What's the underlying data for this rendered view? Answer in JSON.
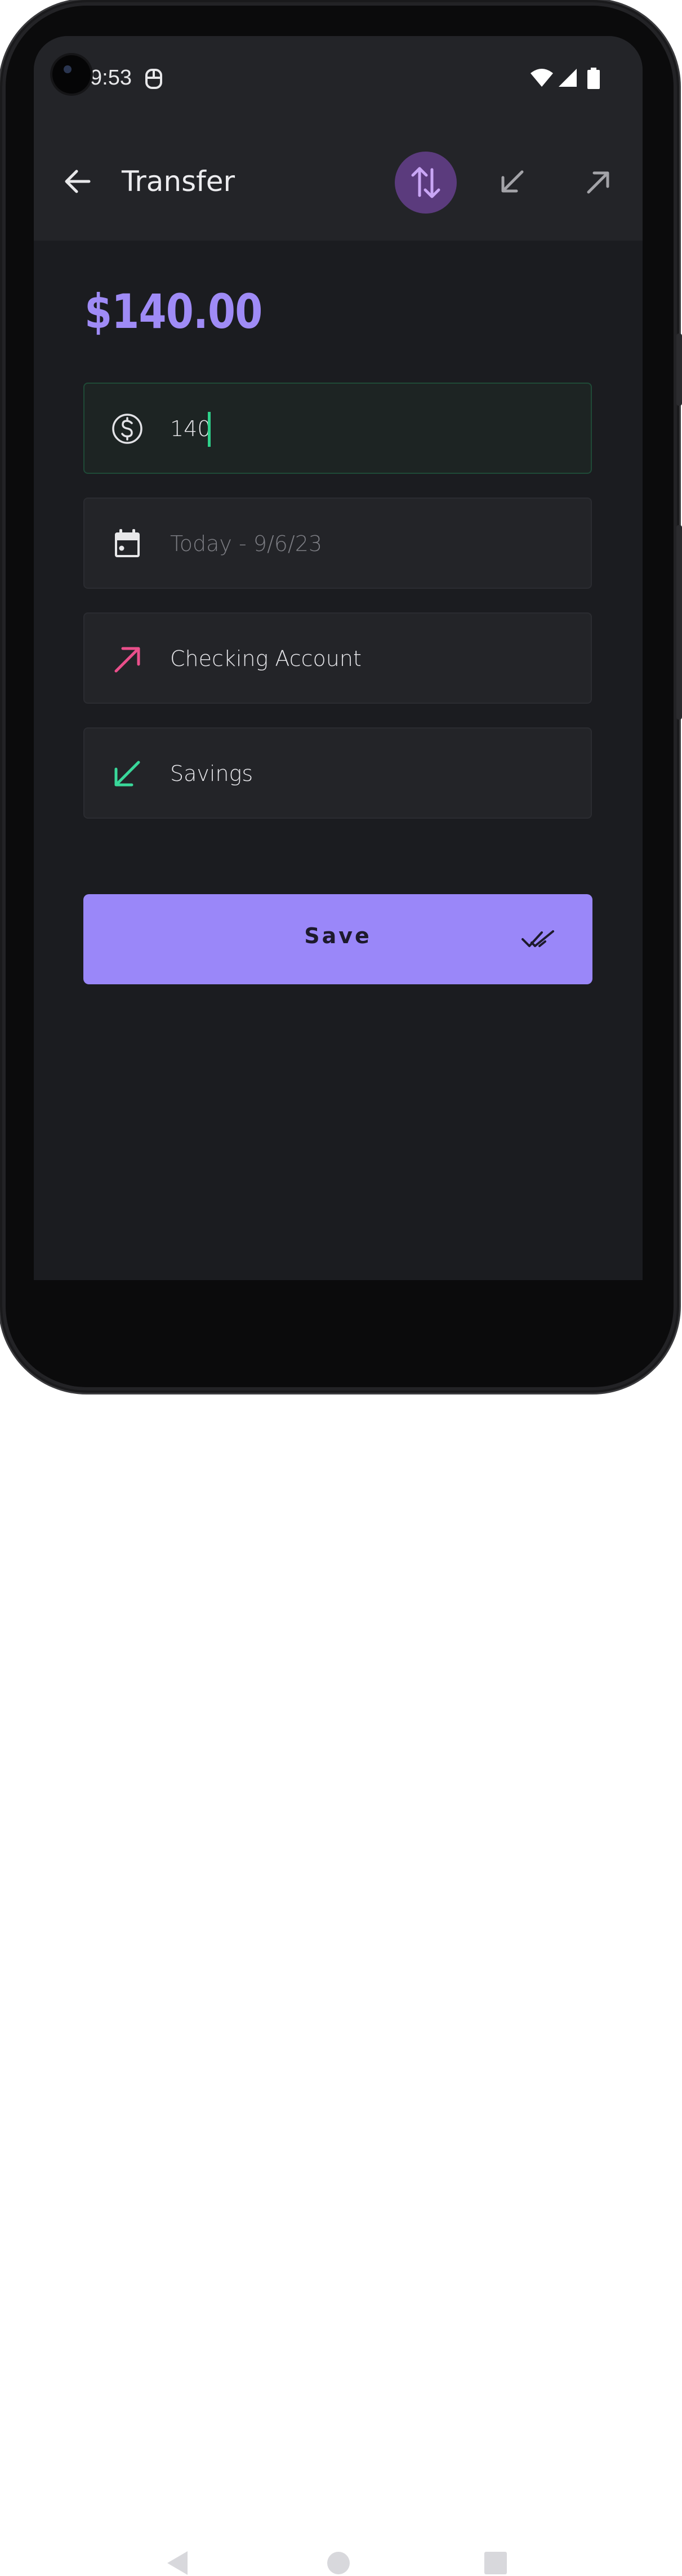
{
  "status_bar": {
    "time": "9:53"
  },
  "app_bar": {
    "title": "Transfer",
    "types": [
      "transfer",
      "income",
      "expense"
    ],
    "selected_type": "transfer"
  },
  "amount_display": "$140.00",
  "form": {
    "amount_value": "140",
    "date_placeholder": "Today - 9/6/23",
    "from_account": "Checking Account",
    "to_account": "Savings"
  },
  "save_button": {
    "label": "Save"
  },
  "colors": {
    "accent": "#9a87f9",
    "amount": "#9f8bf6",
    "from_arrow": "#ea4f8b",
    "to_arrow": "#39d89a",
    "caret": "#2fd08a",
    "selected_type_bg": "#5b3b7d"
  }
}
